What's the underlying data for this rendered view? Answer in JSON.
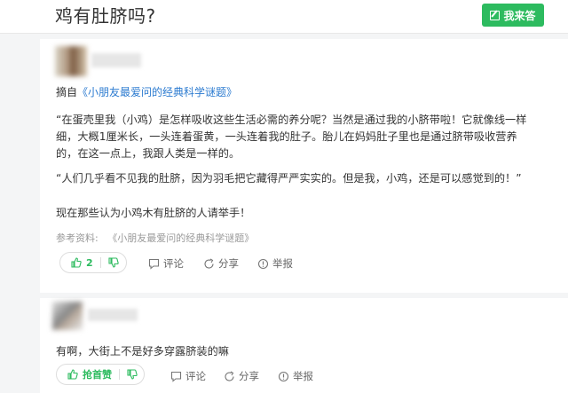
{
  "header": {
    "question_title": "鸡有肚脐吗?",
    "ask_button_label": "我来答"
  },
  "answer1": {
    "source_prefix": "摘自",
    "source_link": "《小朋友最爱问的经典科学谜题》",
    "paragraphs": [
      "“在蛋壳里我（小鸡）是怎样吸收这些生活必需的养分呢？当然是通过我的小脐带啦！它就像线一样",
      "细，大概1厘米长，一头连着蛋黄，一头连着我的肚子。胎儿在妈妈肚子里也是通过脐带吸收营养",
      "的，在这一点上，我跟人类是一样的。",
      "“人们几乎看不见我的肚脐，因为羽毛把它藏得严严实实的。但是我，小鸡，还是可以感觉到的！”",
      "现在那些认为小鸡木有肚脐的人请举手！"
    ],
    "reference_label": "参考资料:",
    "reference_value": "《小朋友最爱问的经典科学谜题》",
    "upvote_count": "2",
    "actions": {
      "comment": "评论",
      "share": "分享",
      "report": "举报"
    }
  },
  "answer2": {
    "text": "有啊，大街上不是好多穿露脐装的嘛",
    "upvote_label": "抢首赞",
    "actions": {
      "comment": "评论",
      "share": "分享",
      "report": "举报"
    }
  },
  "colors": {
    "accent": "#2dbb5f",
    "link": "#2c7bd0"
  }
}
